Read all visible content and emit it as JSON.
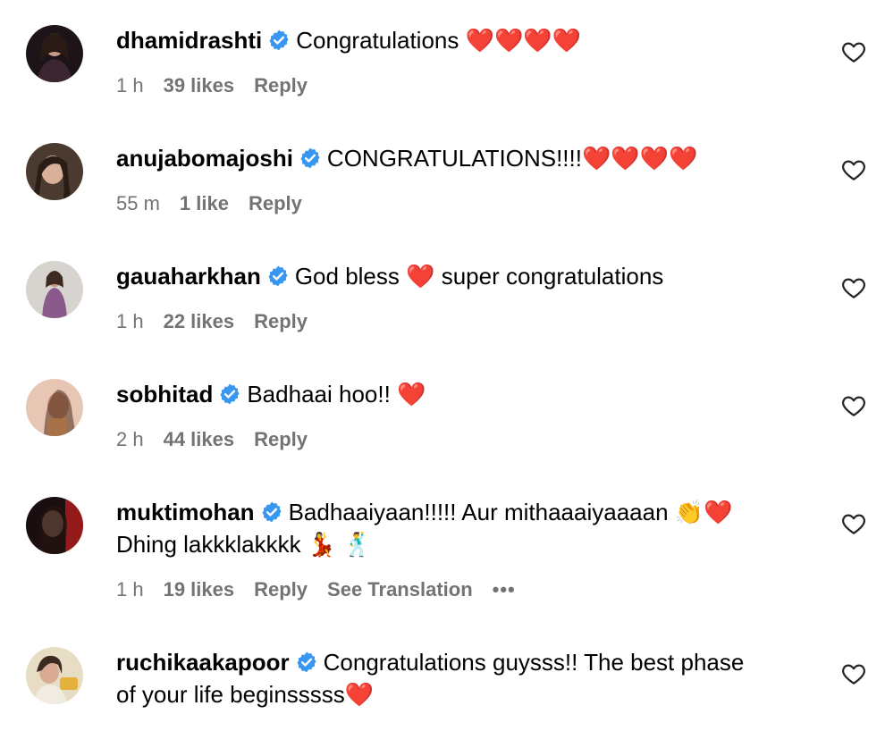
{
  "icons": {
    "verified": "verified-badge-icon",
    "like": "heart-outline-icon",
    "more": "more-options-icon"
  },
  "colors": {
    "verified": "#3897f0",
    "meta_text": "#737373"
  },
  "comments": [
    {
      "username": "dhamidrashti",
      "text": "Congratulations ❤️❤️❤️❤️",
      "time": "1 h",
      "likes": "39 likes",
      "reply": "Reply"
    },
    {
      "username": "anujabomajoshi",
      "text": "CONGRATULATIONS!!!!❤️❤️❤️❤️",
      "time": "55 m",
      "likes": "1 like",
      "reply": "Reply"
    },
    {
      "username": "gauaharkhan",
      "text": "God bless ❤️ super congratulations",
      "time": "1 h",
      "likes": "22 likes",
      "reply": "Reply"
    },
    {
      "username": "sobhitad",
      "text": "Badhaai hoo!! ❤️",
      "time": "2 h",
      "likes": "44 likes",
      "reply": "Reply"
    },
    {
      "username": "muktimohan",
      "text": "Badhaaiyaan!!!!! Aur mithaaaiyaaaan 👏❤️",
      "text_line2": "Dhing lakkklakkkk 💃 🕺",
      "time": "1 h",
      "likes": "19 likes",
      "reply": "Reply",
      "translation": "See Translation",
      "more": "•••"
    },
    {
      "username": "ruchikaakapoor",
      "text": "Congratulations guysss!! The best phase",
      "text_line2": "of your life beginsssss❤️"
    }
  ]
}
